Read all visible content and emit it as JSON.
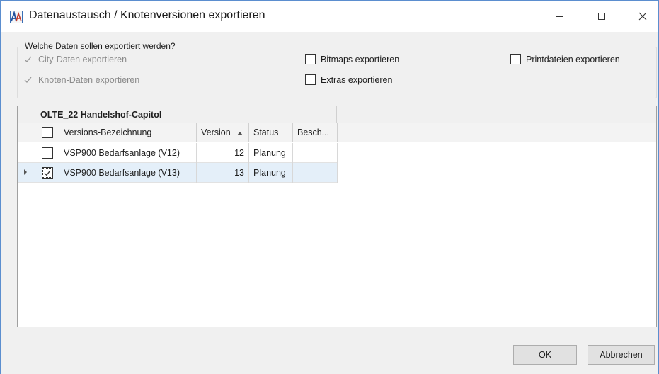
{
  "window": {
    "title": "Datenaustausch / Knotenversionen exportieren",
    "controls": {
      "minimize": "—",
      "maximize": "☐",
      "close": "✕"
    },
    "accent_color": "#5b8ecf"
  },
  "options": {
    "group_label": "Welche Daten sollen exportiert werden?",
    "city": {
      "label": "City-Daten exportieren",
      "checked": true,
      "disabled": true
    },
    "knoten": {
      "label": "Knoten-Daten exportieren",
      "checked": true,
      "disabled": true
    },
    "bitmaps": {
      "label": "Bitmaps exportieren",
      "checked": false
    },
    "extras": {
      "label": "Extras exportieren",
      "checked": false
    },
    "print": {
      "label": "Printdateien exportieren",
      "checked": false
    }
  },
  "grid": {
    "group_title": "OLTE_22 Handelshof-Capitol",
    "columns": {
      "name": "Versions-Bezeichnung",
      "version": "Version",
      "status": "Status",
      "desc": "Besch..."
    },
    "sort_icon": "sort-ascending-icon",
    "rows": [
      {
        "name": "VSP900 Bedarfsanlage (V12)",
        "version": "12",
        "status": "Planung",
        "desc": "",
        "checked": false,
        "selected": false
      },
      {
        "name": "VSP900 Bedarfsanlage (V13)",
        "version": "13",
        "status": "Planung",
        "desc": "",
        "checked": true,
        "selected": true
      }
    ]
  },
  "buttons": {
    "ok": "OK",
    "cancel": "Abbrechen"
  }
}
